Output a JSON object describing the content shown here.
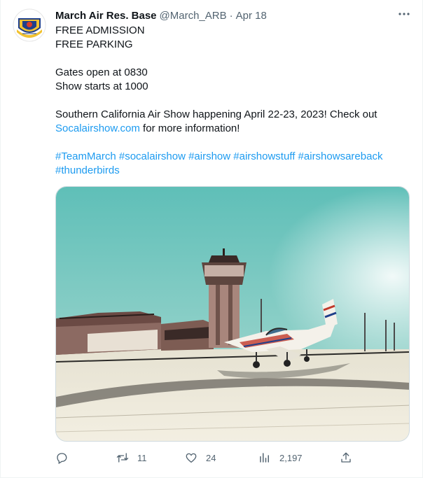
{
  "account": {
    "display_name": "March Air Res. Base",
    "handle": "@March_ARB",
    "separator": "·",
    "timestamp": "Apr 18",
    "avatar_icon": "unit-insignia-emblem"
  },
  "tweet": {
    "lines": [
      "FREE ADMISSION",
      "FREE PARKING",
      "",
      "Gates open at 0830",
      "Show starts at 1000",
      "",
      "Southern California Air Show happening April 22-23, 2023! Check out"
    ],
    "link_text": "Socalairshow.com",
    "link_suffix": " for more information!",
    "hashtags_line1": "#TeamMarch #socalairshow #airshow #airshowstuff #airshowsareback",
    "hashtags_line2": "#thunderbirds"
  },
  "media": {
    "description_icon": "airfield-photo"
  },
  "actions": {
    "reply": {
      "icon": "reply-icon",
      "count": ""
    },
    "retweet": {
      "icon": "retweet-icon",
      "count": "11"
    },
    "like": {
      "icon": "heart-icon",
      "count": "24"
    },
    "views": {
      "icon": "views-icon",
      "count": "2,197"
    },
    "share": {
      "icon": "share-icon",
      "count": ""
    }
  },
  "colors": {
    "accent": "#1d9bf0",
    "text": "#0f1419",
    "secondary": "#536471",
    "border": "#cfd9de"
  }
}
